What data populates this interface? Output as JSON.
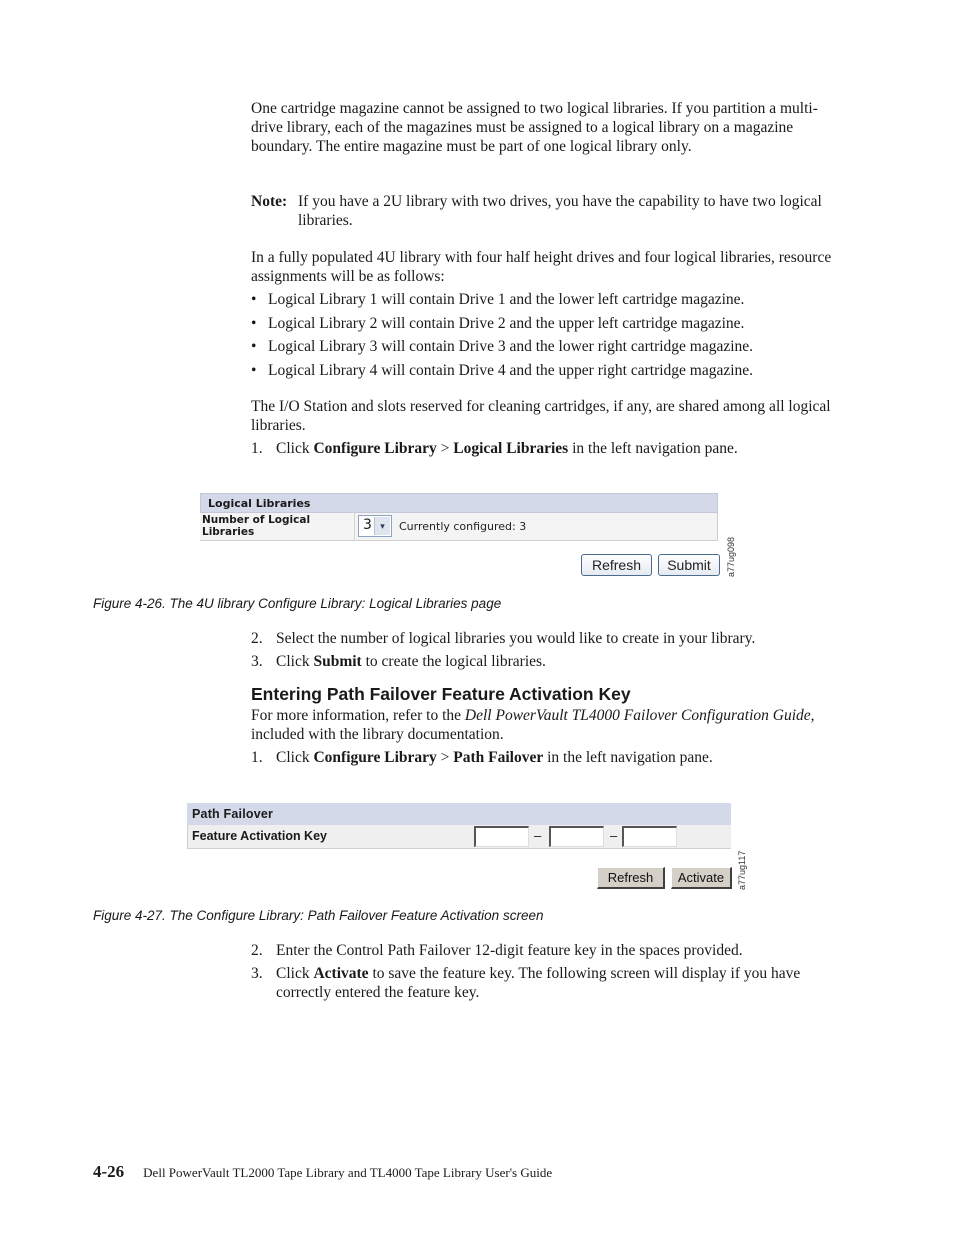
{
  "intro_paragraph": "One cartridge magazine cannot be assigned to two logical libraries. If you partition a multi-drive library, each of the magazines must be assigned to a logical library on a magazine boundary. The entire magazine must be part of one logical library only.",
  "note": {
    "label": "Note:",
    "text": "If you have a 2U library with two drives, you have the capability to have two logical libraries."
  },
  "assignment_intro": "In a fully populated 4U library with four half height drives and four logical libraries, resource assignments will be as follows:",
  "bullets": [
    "Logical Library 1 will contain Drive 1 and the lower left cartridge magazine.",
    "Logical Library 2 will contain Drive 2 and the upper left cartridge magazine.",
    "Logical Library 3 will contain Drive 3 and the lower right cartridge magazine.",
    "Logical Library 4 will contain Drive 4 and the upper right cartridge magazine."
  ],
  "shared_paragraph": "The I/O Station and slots reserved for cleaning cartridges, if any, are shared among all logical libraries.",
  "steps_a": [
    {
      "num": "1.",
      "pre": "Click ",
      "bold1": "Configure Library",
      "mid": " > ",
      "bold2": "Logical Libraries",
      "post": " in the left navigation pane."
    }
  ],
  "figure1": {
    "header": "Logical Libraries",
    "row_label": "Number of Logical Libraries",
    "select_value": "3",
    "select_arrow": "▾",
    "currently_configured": "Currently configured: 3",
    "refresh_label": "Refresh",
    "submit_label": "Submit",
    "code": "a77ug098",
    "caption": "Figure 4-26. The 4U library Configure Library: Logical Libraries page"
  },
  "steps_b": [
    {
      "num": "2.",
      "text": "Select the number of logical libraries you would like to create in your library."
    },
    {
      "num": "3.",
      "pre": "Click ",
      "bold": "Submit",
      "post": " to create the logical libraries."
    }
  ],
  "section": {
    "heading": "Entering Path Failover Feature Activation Key",
    "intro_pre": "For more information, refer to the ",
    "intro_italic": "Dell PowerVault TL4000 Failover Configuration Guide",
    "intro_post": ", included with the library documentation.",
    "step1": {
      "num": "1.",
      "pre": "Click ",
      "bold1": "Configure Library",
      "mid": " > ",
      "bold2": "Path Failover",
      "post": " in the left navigation pane."
    }
  },
  "figure2": {
    "header": "Path Failover",
    "row_label": "Feature Activation Key",
    "key_fields": [
      "",
      "",
      ""
    ],
    "separator": "–",
    "refresh_label": "Refresh",
    "activate_label": "Activate",
    "code": "a77ug117",
    "caption": "Figure 4-27. The Configure Library: Path Failover Feature Activation screen"
  },
  "steps_c": [
    {
      "num": "2.",
      "text": "Enter the Control Path Failover 12-digit feature key in the spaces provided."
    },
    {
      "num": "3.",
      "pre": "Click ",
      "bold": "Activate",
      "post": " to save the feature key. The following screen will display if you have correctly entered the feature key."
    }
  ],
  "footer": {
    "page_number": "4-26",
    "title": "Dell PowerVault TL2000 Tape Library and TL4000 Tape Library User's Guide"
  }
}
